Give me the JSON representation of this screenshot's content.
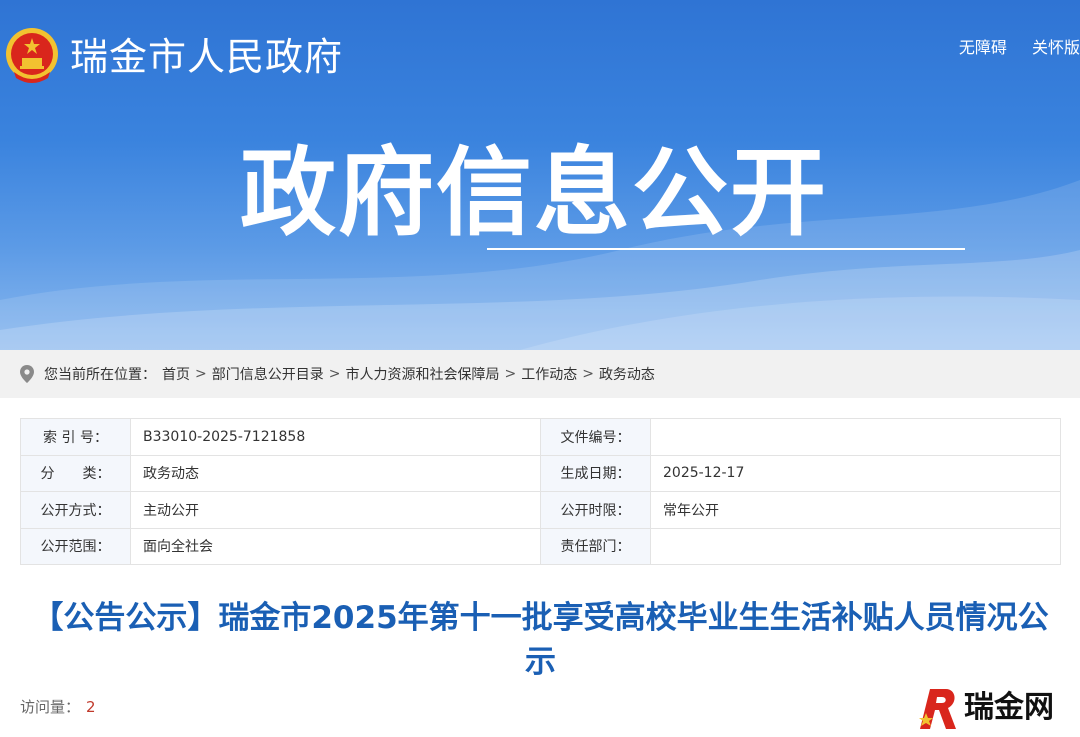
{
  "header": {
    "site_name": "瑞金市人民政府",
    "links": [
      "无障碍",
      "关怀版"
    ],
    "banner_title": "政府信息公开"
  },
  "breadcrumb": {
    "prefix": "您当前所在位置：",
    "items": [
      "首页",
      "部门信息公开目录",
      "市人力资源和社会保障局",
      "工作动态",
      "政务动态"
    ],
    "separator": ">"
  },
  "info": {
    "rows": [
      {
        "label1": "索 引 号：",
        "value1": "B33010-2025-7121858",
        "label2": "文件编号：",
        "value2": ""
      },
      {
        "label1": "分　　类：",
        "value1": "政务动态",
        "label2": "生成日期：",
        "value2": "2025-12-17"
      },
      {
        "label1": "公开方式：",
        "value1": "主动公开",
        "label2": "公开时限：",
        "value2": "常年公开"
      },
      {
        "label1": "公开范围：",
        "value1": "面向全社会",
        "label2": "责任部门：",
        "value2": ""
      }
    ]
  },
  "article": {
    "title": "【公告公示】瑞金市2025年第十一批享受高校毕业生生活补贴人员情况公示",
    "views_label": "访问量：",
    "views_count": "2"
  },
  "watermark": {
    "text": "瑞金网"
  },
  "colors": {
    "banner": "#3a83de",
    "title_blue": "#1a5fb4",
    "count_red": "#c0392b",
    "label_bg": "#f4f7fc"
  }
}
